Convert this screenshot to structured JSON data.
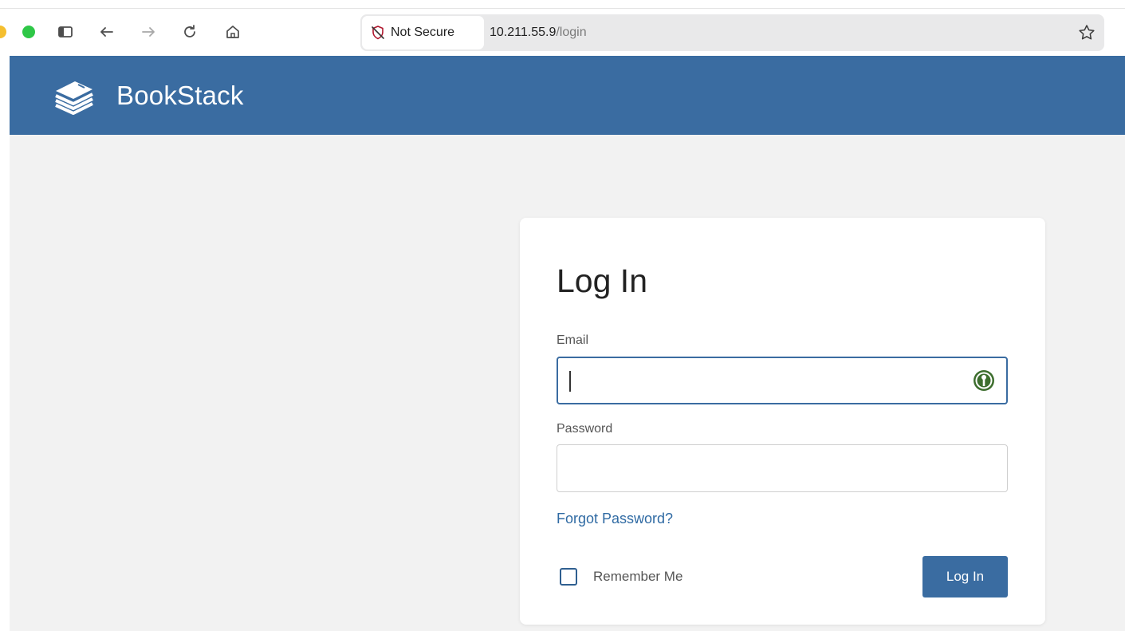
{
  "browser": {
    "security_label": "Not Secure",
    "url_host": "10.211.55.9",
    "url_path": "/login",
    "icons": {
      "sidebar": "sidebar-icon",
      "back": "arrow-left-icon",
      "forward": "arrow-right-icon",
      "reload": "reload-icon",
      "home": "home-icon",
      "security": "shield-slash-icon",
      "bookmark": "star-icon"
    }
  },
  "header": {
    "brand": "BookStack",
    "color": "#3a6ca1"
  },
  "login": {
    "title": "Log In",
    "email_label": "Email",
    "email_value": "",
    "password_label": "Password",
    "password_value": "",
    "forgot_link": "Forgot Password?",
    "remember_label": "Remember Me",
    "remember_checked": false,
    "submit_label": "Log In",
    "accent_color": "#3a6ca1",
    "link_color": "#2f6aa3"
  }
}
